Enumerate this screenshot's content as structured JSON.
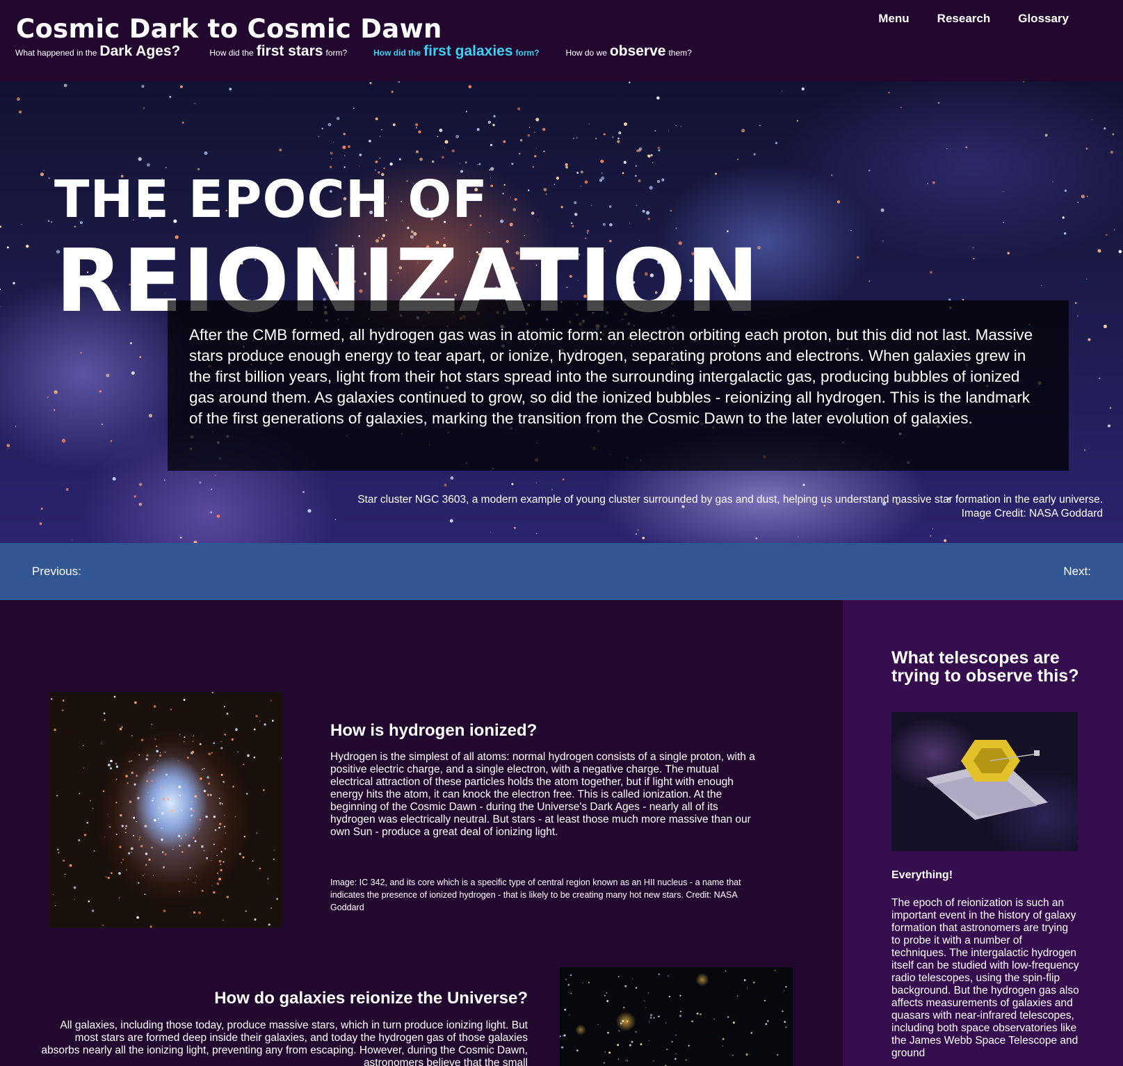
{
  "header": {
    "site_title": "Cosmic Dark to Cosmic Dawn",
    "subnav": [
      {
        "pre": "What happened in the",
        "big": "Dark Ages?",
        "post": ""
      },
      {
        "pre": "How did the",
        "big": "first stars",
        "post": "form?"
      },
      {
        "pre": "How did the",
        "big": "first galaxies",
        "post": "form?"
      },
      {
        "pre": "How do we",
        "big": "observe",
        "post": "them?"
      }
    ],
    "active_color": "#3cd2ef",
    "topnav": [
      "Menu",
      "Research",
      "Glossary"
    ]
  },
  "hero": {
    "title_small": "THE EPOCH OF",
    "title_big": "REIONIZATION",
    "intro": "After the CMB formed, all hydrogen gas was in atomic form: an electron orbiting each proton, but this did not last. Massive stars produce enough energy to tear apart, or ionize, hydrogen, separating protons and electrons. When galaxies grew in the first billion years, light from their hot stars spread into the surrounding intergalactic gas, producing bubbles of ionized gas around them. As galaxies continued to grow, so did the ionized bubbles - reionizing all hydrogen. This is the landmark of the first generations of galaxies, marking the transition from the Cosmic Dawn to the later evolution of galaxies.",
    "caption_line1": "Star cluster NGC 3603, a modern example of young cluster surrounded by gas and dust, helping us understand massive star formation in the early universe.",
    "caption_line2": "Image Credit: NASA Goddard"
  },
  "pagebar": {
    "previous": "Previous:",
    "next": "Next:",
    "color": "#325594"
  },
  "main": {
    "section1": {
      "title": "How is hydrogen ionized?",
      "body": "Hydrogen is the simplest of all atoms: normal hydrogen consists of a single proton, with a positive electric charge, and a single electron, with a negative charge. The mutual electrical attraction of these particles holds the atom together, but if light with enough energy hits the atom, it can knock the electron free. This is called ionization. At the beginning of the Cosmic Dawn - during the Universe's Dark Ages - nearly all of its hydrogen was electrically neutral. But stars - at least those much more massive than our own Sun - produce a great deal of ionizing light.",
      "credit": "Image: IC 342, and its core which is a specific type of central region known as an HII nucleus - a name that indicates the presence of ionized hydrogen - that is likely to be creating many hot new stars. Credit: NASA Goddard"
    },
    "section2": {
      "title": "How do galaxies reionize the Universe?",
      "body": "All galaxies, including those today, produce massive stars, which in turn produce ionizing light. But most stars are formed deep inside their galaxies, and today the hydrogen gas of those galaxies absorbs nearly all the ionizing light, preventing any from escaping. However, during the Cosmic Dawn, astronomers believe that the small"
    }
  },
  "sidebar": {
    "title": "What telescopes are trying to observe this?",
    "subtitle": "Everything!",
    "body": "The epoch of reionization is such an important event in the history of galaxy formation that astronomers are trying to probe it with a number of techniques. The intergalactic hydrogen itself can be studied with low-frequency radio telescopes, using the spin-flip background. But the hydrogen gas also affects measurements of galaxies and quasars with near-infrared telescopes, including both space observatories like the James Webb Space Telescope and ground",
    "background": "#350c4e"
  }
}
